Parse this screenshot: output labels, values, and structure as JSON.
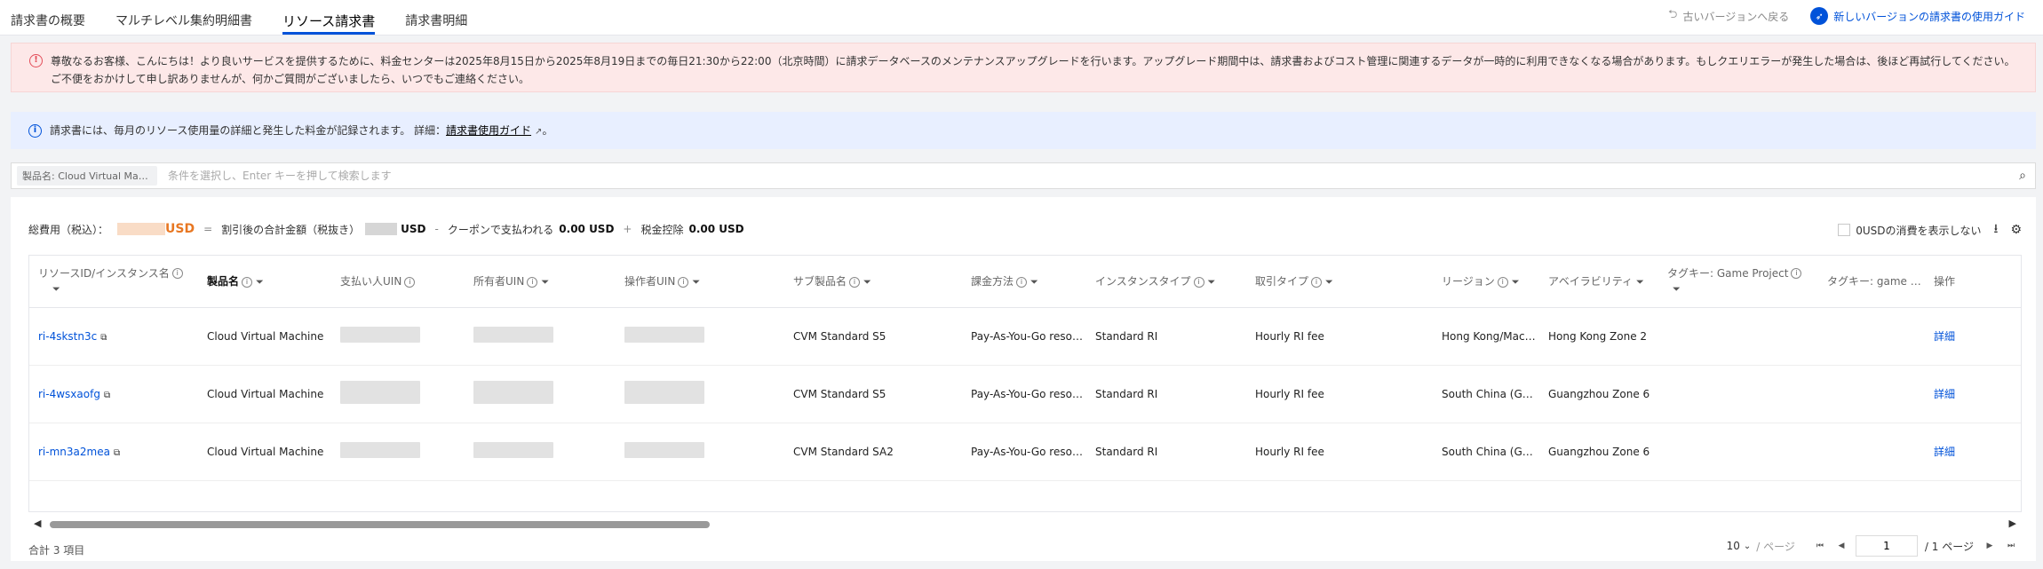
{
  "tabs": [
    {
      "label": "請求書の概要"
    },
    {
      "label": "マルチレベル集約明細書"
    },
    {
      "label": "リソース請求書"
    },
    {
      "label": "請求書明細"
    }
  ],
  "top_right": {
    "old_version": "古いバージョンへ戻る",
    "new_version": "新しいバージョンの請求書の使用ガイド"
  },
  "alert_red": {
    "line1": "尊敬なるお客様、こんにちは！より良いサービスを提供するために、料金センターは2025年8月15日から2025年8月19日までの毎日21:30から22:00（北京時間）に請求データベースのメンテナンスアップグレードを行います。アップグレード期間中は、請求書およびコスト管理に関連するデータが一時的に利用できなくなる場合があります。もしクエリエラーが発生した場合は、後ほど再試行してください。",
    "line2": "ご不便をおかけして申し訳ありませんが、何かご質問がございましたら、いつでもご連絡ください。"
  },
  "alert_blue": {
    "text": "請求書には、毎月のリソース使用量の詳細と発生した料金が記録されます。 詳細：",
    "link": "請求書使用ガイド",
    "end": "。"
  },
  "search": {
    "chip": "製品名: Cloud Virtual Machine",
    "placeholder": "条件を選択し、Enter キーを押して検索します"
  },
  "summary": {
    "total_label": "総費用（税込）：",
    "usd": "USD",
    "eq": "=",
    "after_discount": "割引後の合計金額（税抜き）",
    "usd2": "USD",
    "minus": "-",
    "coupon": "クーポンで支払われる",
    "coupon_value": "0.00 USD",
    "plus": "+",
    "tax": "税金控除",
    "tax_value": "0.00 USD",
    "hide_zero": "0USDの消費を表示しない"
  },
  "columns": [
    {
      "label": "リソースID/インスタンス名",
      "info": true,
      "filter": true
    },
    {
      "label": "製品名",
      "info": true,
      "filter": true
    },
    {
      "label": "支払い人UIN",
      "info": true,
      "filter": false
    },
    {
      "label": "所有者UIN",
      "info": true,
      "filter": true
    },
    {
      "label": "操作者UIN",
      "info": true,
      "filter": true
    },
    {
      "label": "サブ製品名",
      "info": true,
      "filter": true
    },
    {
      "label": "課金方法",
      "info": true,
      "filter": true
    },
    {
      "label": "インスタンスタイプ",
      "info": true,
      "filter": true
    },
    {
      "label": "取引タイプ",
      "info": true,
      "filter": true
    },
    {
      "label": "リージョン",
      "info": true,
      "filter": true
    },
    {
      "label": "アベイラビリティ",
      "info": false,
      "filter": true
    },
    {
      "label": "タグキー: Game Project",
      "info": true,
      "filter": true
    },
    {
      "label": "タグキー: game group",
      "info": false,
      "filter": false
    },
    {
      "label": "操作",
      "info": false,
      "filter": false
    }
  ],
  "rows": [
    {
      "id": "ri-4skstn3c",
      "product": "Cloud Virtual Machine",
      "sub_product": "CVM Standard S5",
      "billing": "Pay-As-You-Go resource",
      "instance_type": "Standard RI",
      "transaction": "Hourly RI fee",
      "region": "Hong Kong/Macau/Taiwan",
      "zone": "Hong Kong Zone 2",
      "action": "詳細"
    },
    {
      "id": "ri-4wsxaofg",
      "product": "Cloud Virtual Machine",
      "sub_product": "CVM Standard S5",
      "billing": "Pay-As-You-Go resource",
      "instance_type": "Standard RI",
      "transaction": "Hourly RI fee",
      "region": "South China (Guangzhou)",
      "zone": "Guangzhou Zone 6",
      "action": "詳細"
    },
    {
      "id": "ri-mn3a2mea",
      "product": "Cloud Virtual Machine",
      "sub_product": "CVM Standard SA2",
      "billing": "Pay-As-You-Go resource",
      "instance_type": "Standard RI",
      "transaction": "Hourly RI fee",
      "region": "South China (Guangzhou)",
      "zone": "Guangzhou Zone 6",
      "action": "詳細"
    }
  ],
  "footer": {
    "total": "合計 3 項目",
    "page_size": "10",
    "per_page": "/ ページ",
    "page": "1",
    "of_pages": "/ 1 ページ"
  },
  "colors": {
    "accent": "#0052d9",
    "warn": "#e34d59",
    "usd_orange": "#e87722"
  },
  "icons": [
    "undo-icon",
    "rocket-icon",
    "alert-icon",
    "info-icon",
    "external-link-icon",
    "search-icon",
    "download-icon",
    "settings-icon",
    "copy-icon",
    "filter-icon"
  ]
}
